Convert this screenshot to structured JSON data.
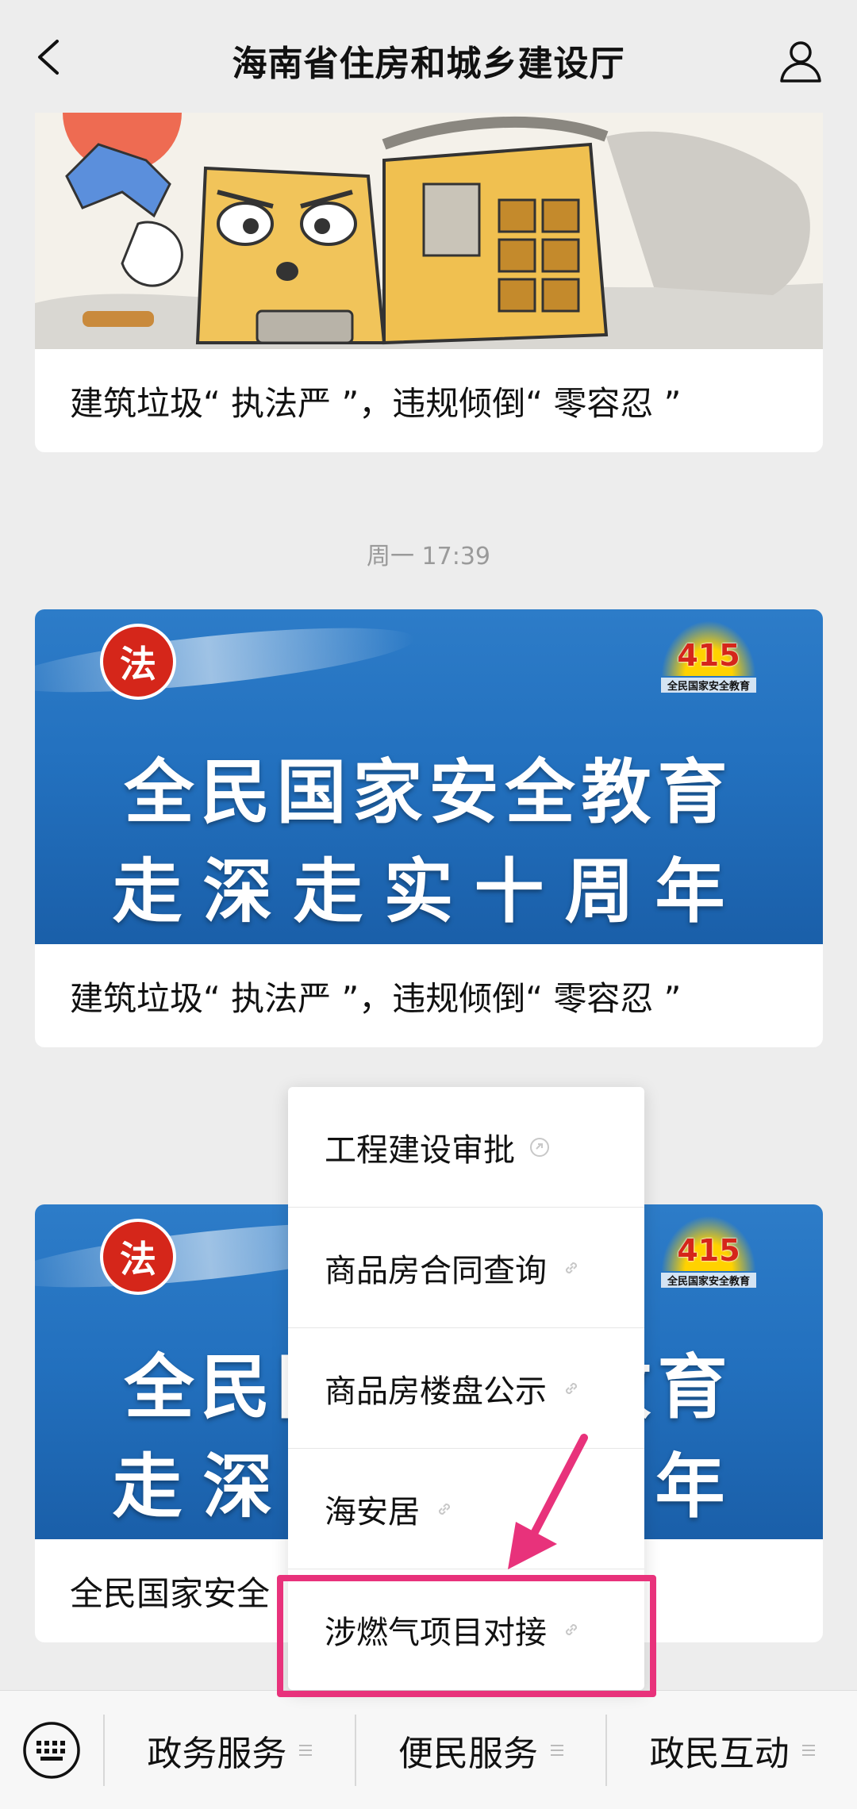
{
  "header": {
    "title": "海南省住房和城乡建设厅"
  },
  "messages": [
    {
      "caption": "建筑垃圾“ 执法严 ”，违规倾倒“ 零容忍 ”"
    },
    {
      "caption": "建筑垃圾“ 执法严 ”，违规倾倒“ 零容忍 ”",
      "banner": {
        "logo_left": "法",
        "logo_right_num": "415",
        "logo_right_sub": "全民国家安全教育",
        "line1": "全民国家安全教育",
        "line2": "走深走实十周年"
      }
    },
    {
      "caption": "全民国家安全",
      "banner": {
        "logo_left": "法",
        "logo_right_num": "415",
        "logo_right_sub": "全民国家安全教育",
        "line1": "全民国家安全教育",
        "line2": "走深走实十周年"
      }
    }
  ],
  "timestamp": "周一 17:39",
  "popup_menu": {
    "items": [
      {
        "label": "工程建设审批",
        "icon": "link-icon"
      },
      {
        "label": "商品房合同查询",
        "icon": "link-icon"
      },
      {
        "label": "商品房楼盘公示",
        "icon": "link-icon"
      },
      {
        "label": "海安居",
        "icon": "link-icon"
      },
      {
        "label": "涉燃气项目对接",
        "icon": "link-icon",
        "highlighted": true
      }
    ]
  },
  "bottom_menu": {
    "keyboard_icon": "keyboard-icon",
    "items": [
      {
        "label": "政务服务"
      },
      {
        "label": "便民服务"
      },
      {
        "label": "政民互动"
      }
    ]
  },
  "colors": {
    "highlight": "#e8327b",
    "banner_blue": "#2371bf",
    "background": "#ededed"
  }
}
